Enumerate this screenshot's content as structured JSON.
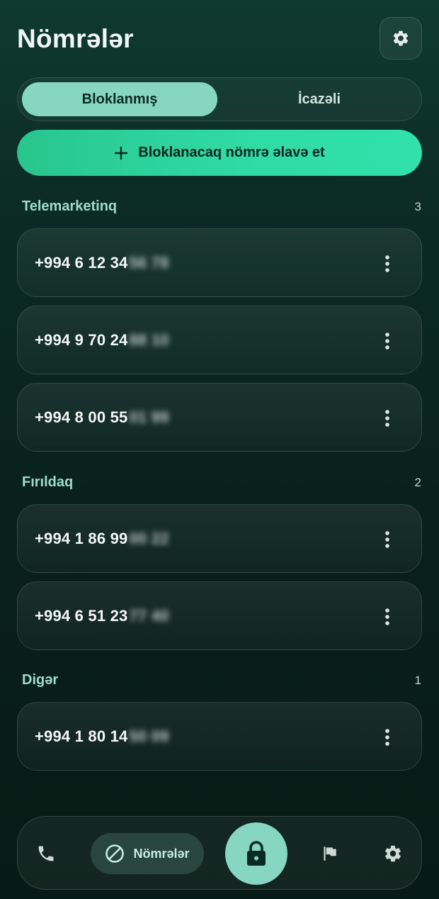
{
  "header": {
    "title": "Nömrələr"
  },
  "tabs": [
    {
      "label": "Bloklanmış",
      "active": true
    },
    {
      "label": "İcazəli",
      "active": false
    }
  ],
  "add_button": {
    "label": "Bloklanacaq nömrə əlavə et"
  },
  "sections": [
    {
      "title": "Telemarketinq",
      "count": "3",
      "items": [
        {
          "number_visible": "+994 6 12 34",
          "number_hidden": "56 78"
        },
        {
          "number_visible": "+994 9 70 24",
          "number_hidden": "88 10"
        },
        {
          "number_visible": "+994 8 00 55",
          "number_hidden": "01 99"
        }
      ]
    },
    {
      "title": "Fırıldaq",
      "count": "2",
      "items": [
        {
          "number_visible": "+994 1 86 99",
          "number_hidden": "00 22"
        },
        {
          "number_visible": "+994 6 51 23",
          "number_hidden": "77 40"
        }
      ]
    },
    {
      "title": "Digər",
      "count": "1",
      "items": [
        {
          "number_visible": "+994 1 80 14",
          "number_hidden": "50 09"
        }
      ]
    }
  ],
  "bottom_nav": {
    "items": [
      {
        "icon": "phone-icon"
      },
      {
        "icon": "block-icon",
        "label": "Nömrələr",
        "active": true
      },
      {
        "icon": "lock-icon"
      },
      {
        "icon": "flag-icon"
      },
      {
        "icon": "gear-icon"
      }
    ]
  },
  "colors": {
    "accent": "#86d6c2",
    "primary_button": "#2fdba3",
    "background": "#0b2a23"
  }
}
